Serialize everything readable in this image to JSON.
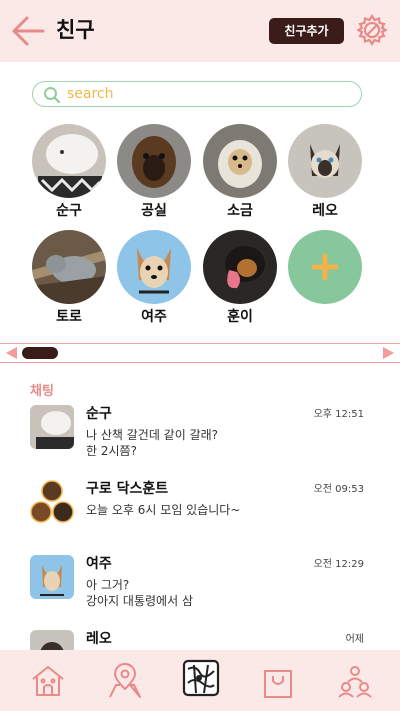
{
  "header": {
    "title": "친구",
    "add_friend_label": "친구추가"
  },
  "search": {
    "placeholder": "search"
  },
  "friends": [
    {
      "name": "순구"
    },
    {
      "name": "공실"
    },
    {
      "name": "소금"
    },
    {
      "name": "레오"
    },
    {
      "name": "토로"
    },
    {
      "name": "여주"
    },
    {
      "name": "훈이"
    }
  ],
  "chats_label": "채팅",
  "chats": [
    {
      "name": "순구",
      "time": "오후 12:51",
      "message": "나 산책 갈건데 같이 갈래?\n한 2시쯤?"
    },
    {
      "name": "구로 닥스훈트",
      "time": "오전 09:53",
      "message": "오늘 오후 6시 모임 있습니다~"
    },
    {
      "name": "여주",
      "time": "오전 12:29",
      "message": "아 그거?\n강아지 대통령에서 삼"
    },
    {
      "name": "레오",
      "time": "어제",
      "message": ""
    }
  ],
  "colors": {
    "header_bg": "#fbe9e8",
    "accent": "#f29b9b",
    "dark_button": "#3a1c1a",
    "add_circle": "#86c79c",
    "plus": "#f5b24a"
  },
  "icons": [
    "back-arrow-icon",
    "gear-icon",
    "search-icon",
    "plus-icon",
    "home-icon",
    "map-pin-icon",
    "map-icon",
    "shopping-bag-icon",
    "people-icon"
  ]
}
